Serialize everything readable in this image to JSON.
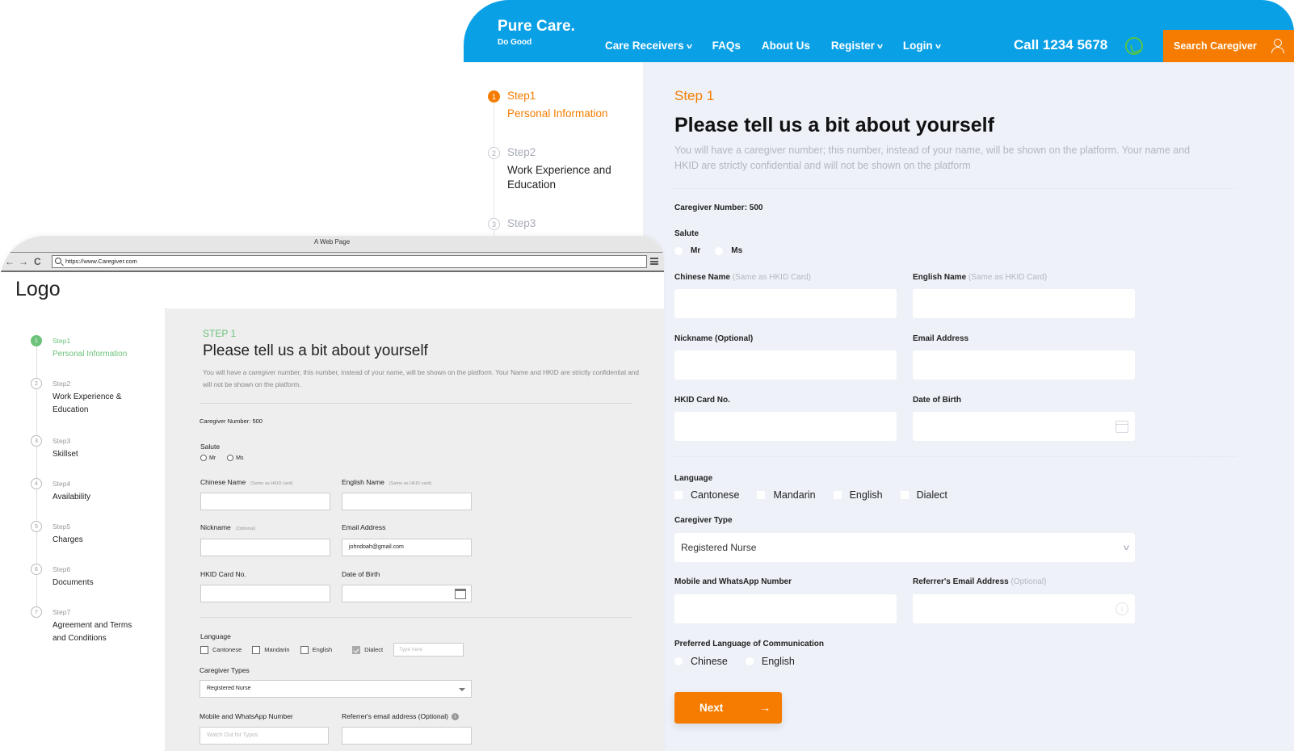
{
  "hifi": {
    "brand": {
      "name": "Pure Care.",
      "tagline": "Do Good"
    },
    "nav": [
      {
        "label": "Care Receivers",
        "dropdown": true
      },
      {
        "label": "FAQs",
        "dropdown": false
      },
      {
        "label": "About Us",
        "dropdown": false
      },
      {
        "label": "Register",
        "dropdown": true
      },
      {
        "label": "Login",
        "dropdown": true
      }
    ],
    "call": "Call 1234 5678",
    "search_caregiver": "Search Caregiver",
    "icons": {
      "whatsapp": "whatsapp-icon",
      "user": "user-icon",
      "calendar": "calendar-icon",
      "info": "info-icon",
      "arrow": "arrow-right-icon"
    },
    "colors": {
      "header": "#0aa0e6",
      "accent": "#f57c00",
      "whatsapp": "#53c44a",
      "main_bg": "#eef1f8"
    },
    "steps": [
      {
        "num": "1",
        "label": "Step1",
        "title": "Personal Information",
        "active": true
      },
      {
        "num": "2",
        "label": "Step2",
        "title": "Work Experience and Education",
        "active": false
      },
      {
        "num": "3",
        "label": "Step3",
        "title": "",
        "active": false
      }
    ],
    "form": {
      "eyebrow": "Step 1",
      "title": "Please tell us a bit about yourself",
      "description": "You will have a caregiver number; this number, instead of your name, will be shown on the platform. Your name and HKID are strictly confidential and will not be shown on the platform",
      "caregiver_number": "Caregiver Number: 500",
      "salute_label": "Salute",
      "salute_options": [
        "Mr",
        "Ms"
      ],
      "chinese_name_label": "Chinese Name",
      "chinese_name_hint": "(Same as HKID Card)",
      "english_name_label": "English Name",
      "english_name_hint": "(Same as HKID Card)",
      "nickname_label": "Nickname (Optional)",
      "email_label": "Email Address",
      "hkid_label": "HKID Card No.",
      "dob_label": "Date of Birth",
      "language_label": "Language",
      "language_options": [
        "Cantonese",
        "Mandarin",
        "English",
        "Dialect"
      ],
      "caregiver_type_label": "Caregiver Type",
      "caregiver_type_value": "Registered Nurse",
      "mobile_label": "Mobile and WhatsApp Number",
      "referrer_label": "Referrer's Email Address",
      "referrer_hint": "(Optional)",
      "pref_lang_label": "Preferred Language of Communication",
      "pref_lang_options": [
        "Chinese",
        "English"
      ],
      "next_label": "Next",
      "next_arrow": "→"
    }
  },
  "wire": {
    "window_title": "A Web Page",
    "url": "https://www.Caregiver.com",
    "logo": "Logo",
    "nav_glyphs": {
      "back": "←",
      "forward": "→",
      "reload": "C"
    },
    "colors": {
      "accent": "#6cc27a",
      "main_bg": "#eeeeee"
    },
    "steps": [
      {
        "num": "1",
        "label": "Step1",
        "title": "Personal Information",
        "active": true
      },
      {
        "num": "2",
        "label": "Step2",
        "title": "Work Experience & Education",
        "active": false
      },
      {
        "num": "3",
        "label": "Step3",
        "title": "Skillset",
        "active": false
      },
      {
        "num": "4",
        "label": "Step4",
        "title": "Availability",
        "active": false
      },
      {
        "num": "5",
        "label": "Step5",
        "title": "Charges",
        "active": false
      },
      {
        "num": "6",
        "label": "Step6",
        "title": "Documents",
        "active": false
      },
      {
        "num": "7",
        "label": "Step7",
        "title": "Agreement and Terms and Conditions",
        "active": false
      }
    ],
    "form": {
      "eyebrow": "STEP 1",
      "title": "Please tell us a bit about yourself",
      "description": "You will have a caregiver number, this number, instead of your name, will be shown on the platform.  Your Name and HKID are strictly confidential and will not be shown on the platform.",
      "caregiver_number": "Caregiver Number:  500",
      "salute_label": "Salute",
      "salute_options": [
        "Mr",
        "Ms"
      ],
      "chinese_name_label": "Chinese Name",
      "chinese_name_hint": "(Same as HKID card)",
      "english_name_label": "English Name",
      "english_name_hint": "(Same as HKID card)",
      "nickname_label": "Nickname",
      "nickname_hint": "(Optional)",
      "email_label": "Email Address",
      "email_value": "johndoah@gmail.com",
      "hkid_label": "HKID Card No.",
      "dob_label": "Date of Birth",
      "language_label": "Language",
      "language_options": [
        {
          "label": "Cantonese",
          "checked": false
        },
        {
          "label": "Mandarin",
          "checked": false
        },
        {
          "label": "English",
          "checked": false
        },
        {
          "label": "Dialect",
          "checked": true
        }
      ],
      "dialect_placeholder": "Type here",
      "caregiver_types_label": "Caregiver Types",
      "caregiver_types_value": "Registered Nurse",
      "mobile_label": "Mobile and WhatsApp Number",
      "mobile_placeholder": "Watch Out for Typos",
      "referrer_label": "Referrer's email address (Optional)",
      "info_glyph": "i"
    }
  }
}
